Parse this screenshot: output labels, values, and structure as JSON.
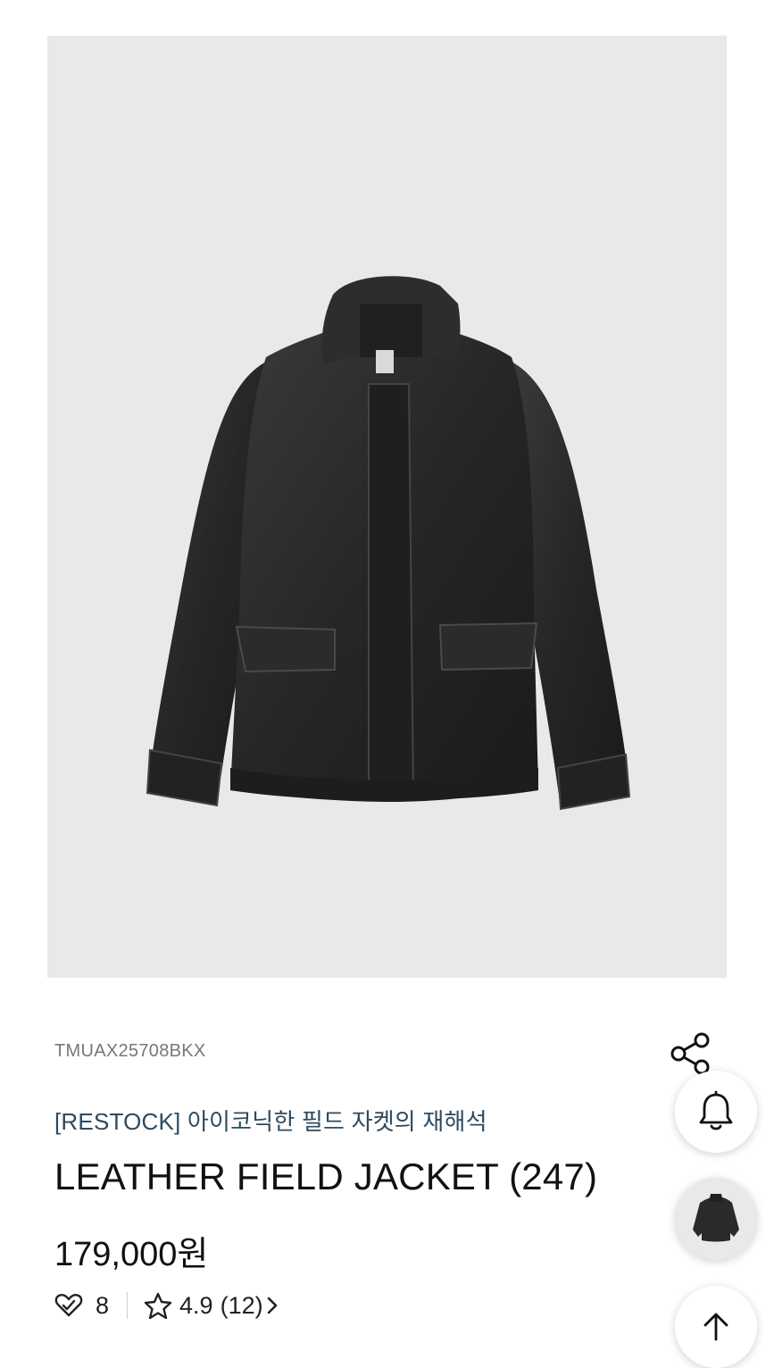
{
  "product": {
    "sku": "TMUAX25708BKX",
    "subtitle": "[RESTOCK] 아이코닉한 필드 자켓의 재해석",
    "title": "LEATHER FIELD JACKET (247)",
    "price": "179,000원",
    "likes": "8",
    "rating": "4.9",
    "review_count": "(12)",
    "image_alt": "black leather field jacket"
  },
  "icons": {
    "share": "share-icon",
    "bell": "bell-icon",
    "heart": "heart-icon",
    "star": "star-icon",
    "chevron": "chevron-right-icon",
    "top": "arrow-up-icon"
  },
  "colors": {
    "image_bg": "#e9e9e7",
    "subtitle": "#2e4a5f",
    "sku": "#777777",
    "jacket": "#2a2a2a"
  }
}
